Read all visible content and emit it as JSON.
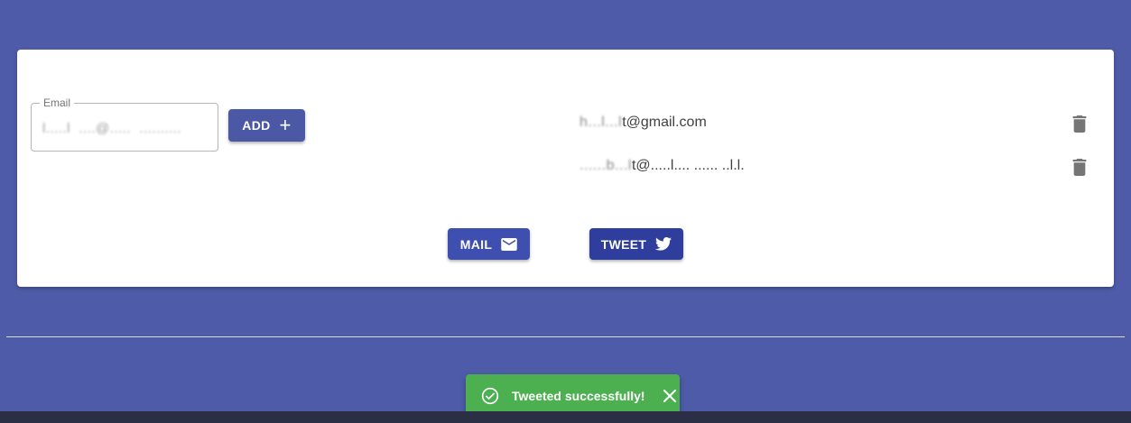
{
  "email_form": {
    "legend": "Email",
    "value": "l.....l  ....@.....  ..........",
    "add_label": "ADD",
    "add_icon": "plus-icon"
  },
  "recipients": [
    {
      "prefix": "h...l...l",
      "visible": "t@gmail.com",
      "delete_icon": "trash-icon"
    },
    {
      "prefix": "......b...l",
      "visible": "t@.....l....  ......  ..l.l.",
      "delete_icon": "trash-icon"
    }
  ],
  "actions": {
    "mail_label": "MAIL",
    "mail_icon": "envelope-icon",
    "tweet_label": "TWEET",
    "tweet_icon": "twitter-bird-icon"
  },
  "snackbar": {
    "message": "Tweeted successfully!",
    "status_icon": "check-circle-icon",
    "close_icon": "close-icon"
  },
  "colors": {
    "background": "#4e5ba8",
    "primary": "#4b58a5",
    "success": "#4caf50",
    "card": "#ffffff"
  }
}
